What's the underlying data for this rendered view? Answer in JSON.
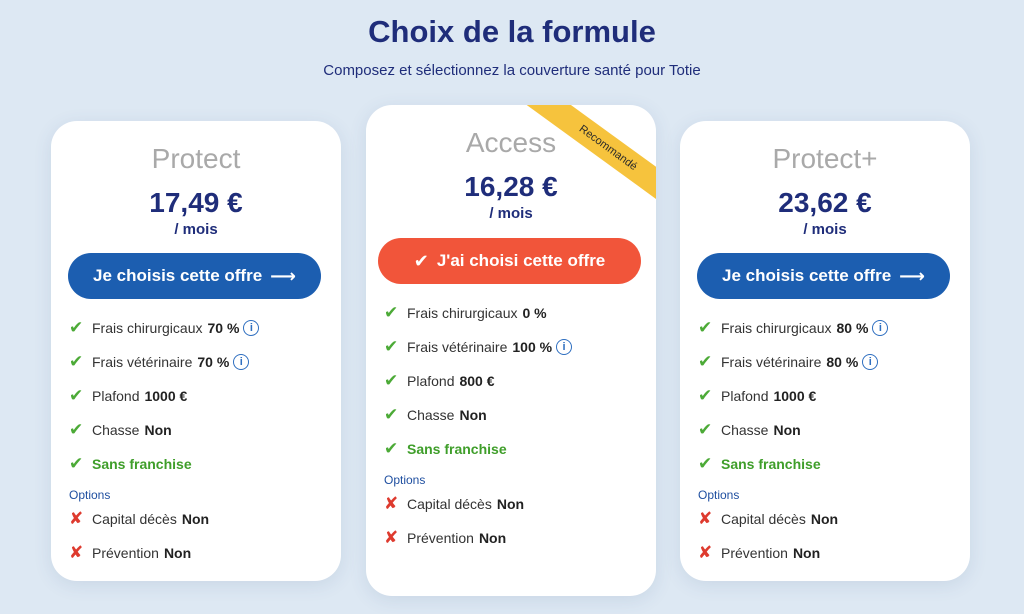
{
  "header": {
    "title": "Choix de la formule",
    "subtitle": "Composez et sélectionnez la couverture santé pour Totie"
  },
  "plans": [
    {
      "name": "Protect",
      "price": "17,49 €",
      "period": "/ mois",
      "button_label": "Je choisis cette offre",
      "button_icon": "arrow-right-icon",
      "features": [
        {
          "label": "Frais chirurgicaux",
          "value": "70 %",
          "info": true
        },
        {
          "label": "Frais vétérinaire",
          "value": "70 %",
          "info": true
        },
        {
          "label": "Plafond",
          "value": "1000 €",
          "info": false
        },
        {
          "label": "Chasse",
          "value": "Non",
          "info": false
        },
        {
          "label": "Sans franchise",
          "value": "",
          "info": false
        }
      ],
      "options_label": "Options",
      "options": [
        {
          "label": "Capital décès",
          "value": "Non"
        },
        {
          "label": "Prévention",
          "value": "Non"
        }
      ]
    },
    {
      "name": "Access",
      "ribbon": "Recommandé",
      "price": "16,28 €",
      "period": "/ mois",
      "button_label": "J'ai choisi cette offre",
      "button_icon": "check-icon",
      "selected": true,
      "features": [
        {
          "label": "Frais chirurgicaux",
          "value": "0 %",
          "info": false
        },
        {
          "label": "Frais vétérinaire",
          "value": "100 %",
          "info": true
        },
        {
          "label": "Plafond",
          "value": "800 €",
          "info": false
        },
        {
          "label": "Chasse",
          "value": "Non",
          "info": false
        },
        {
          "label": "Sans franchise",
          "value": "",
          "info": false
        }
      ],
      "options_label": "Options",
      "options": [
        {
          "label": "Capital décès",
          "value": "Non"
        },
        {
          "label": "Prévention",
          "value": "Non"
        }
      ]
    },
    {
      "name": "Protect+",
      "price": "23,62 €",
      "period": "/ mois",
      "button_label": "Je choisis cette offre",
      "button_icon": "arrow-right-icon",
      "features": [
        {
          "label": "Frais chirurgicaux",
          "value": "80 %",
          "info": true
        },
        {
          "label": "Frais vétérinaire",
          "value": "80 %",
          "info": true
        },
        {
          "label": "Plafond",
          "value": "1000 €",
          "info": false
        },
        {
          "label": "Chasse",
          "value": "Non",
          "info": false
        },
        {
          "label": "Sans franchise",
          "value": "",
          "info": false
        }
      ],
      "options_label": "Options",
      "options": [
        {
          "label": "Capital décès",
          "value": "Non"
        },
        {
          "label": "Prévention",
          "value": "Non"
        }
      ]
    }
  ],
  "colors": {
    "primary": "#1f2d7a",
    "button": "#1c5eb0",
    "selected_button": "#f1553a",
    "ribbon": "#f6c33d",
    "check": "#4caa37",
    "cross": "#de3a2e"
  }
}
